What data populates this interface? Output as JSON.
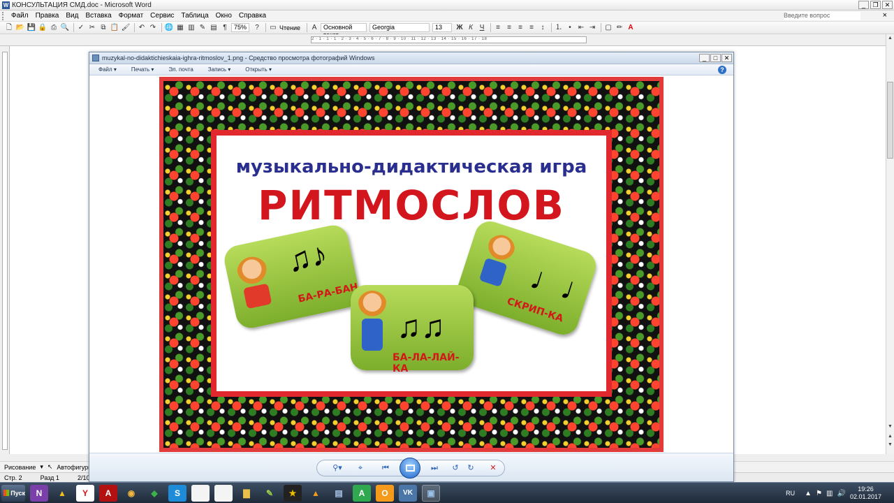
{
  "word": {
    "title": "КОНСУЛЬТАЦИЯ СМД.doc - Microsoft Word",
    "menu": [
      "Файл",
      "Правка",
      "Вид",
      "Вставка",
      "Формат",
      "Сервис",
      "Таблица",
      "Окно",
      "Справка"
    ],
    "help_placeholder": "Введите вопрос",
    "toolbar": {
      "zoom": "75%",
      "reading_label": "Чтение",
      "style": "Основной текст",
      "font": "Georgia",
      "size": "13"
    },
    "ruler_text": "2 · 1 · 1 · 1 · 2 · 3 · 4 · 5 · 6 · 7 · 8 · 9 · 10 · 11 · 12 · 13 · 14 · 15 · 16 · 17 · 18",
    "drawbar": {
      "drawing": "Рисование",
      "autoshapes": "Автофигуры"
    },
    "status": {
      "page": "Стр. 2",
      "section": "Разд 1",
      "pages": "2/10"
    }
  },
  "viewer": {
    "title": "muzykal-no-didaktichieskaia-ighra-ritmoslov_1.png - Средство просмотра фотографий Windows",
    "menu": [
      "Файл",
      "Печать",
      "Эл. почта",
      "Запись",
      "Открыть"
    ]
  },
  "poster": {
    "subtitle": "музыкально-дидактическая игра",
    "title": "РИТМОСЛОВ",
    "cards": [
      {
        "word": "БА-РА-БАН",
        "notes": "♫♪"
      },
      {
        "word": "БА-ЛА-ЛАЙ-КА",
        "notes": "♫♫"
      },
      {
        "word": "СКРИП-КА",
        "notes": "♩♩"
      }
    ]
  },
  "taskbar": {
    "start": "Пуск",
    "lang": "RU",
    "time": "19:26",
    "date": "02.01.2017"
  },
  "colors": {
    "poster_red": "#d3151d",
    "poster_blue": "#2a2f8f",
    "card_green": "#8cbc36"
  }
}
